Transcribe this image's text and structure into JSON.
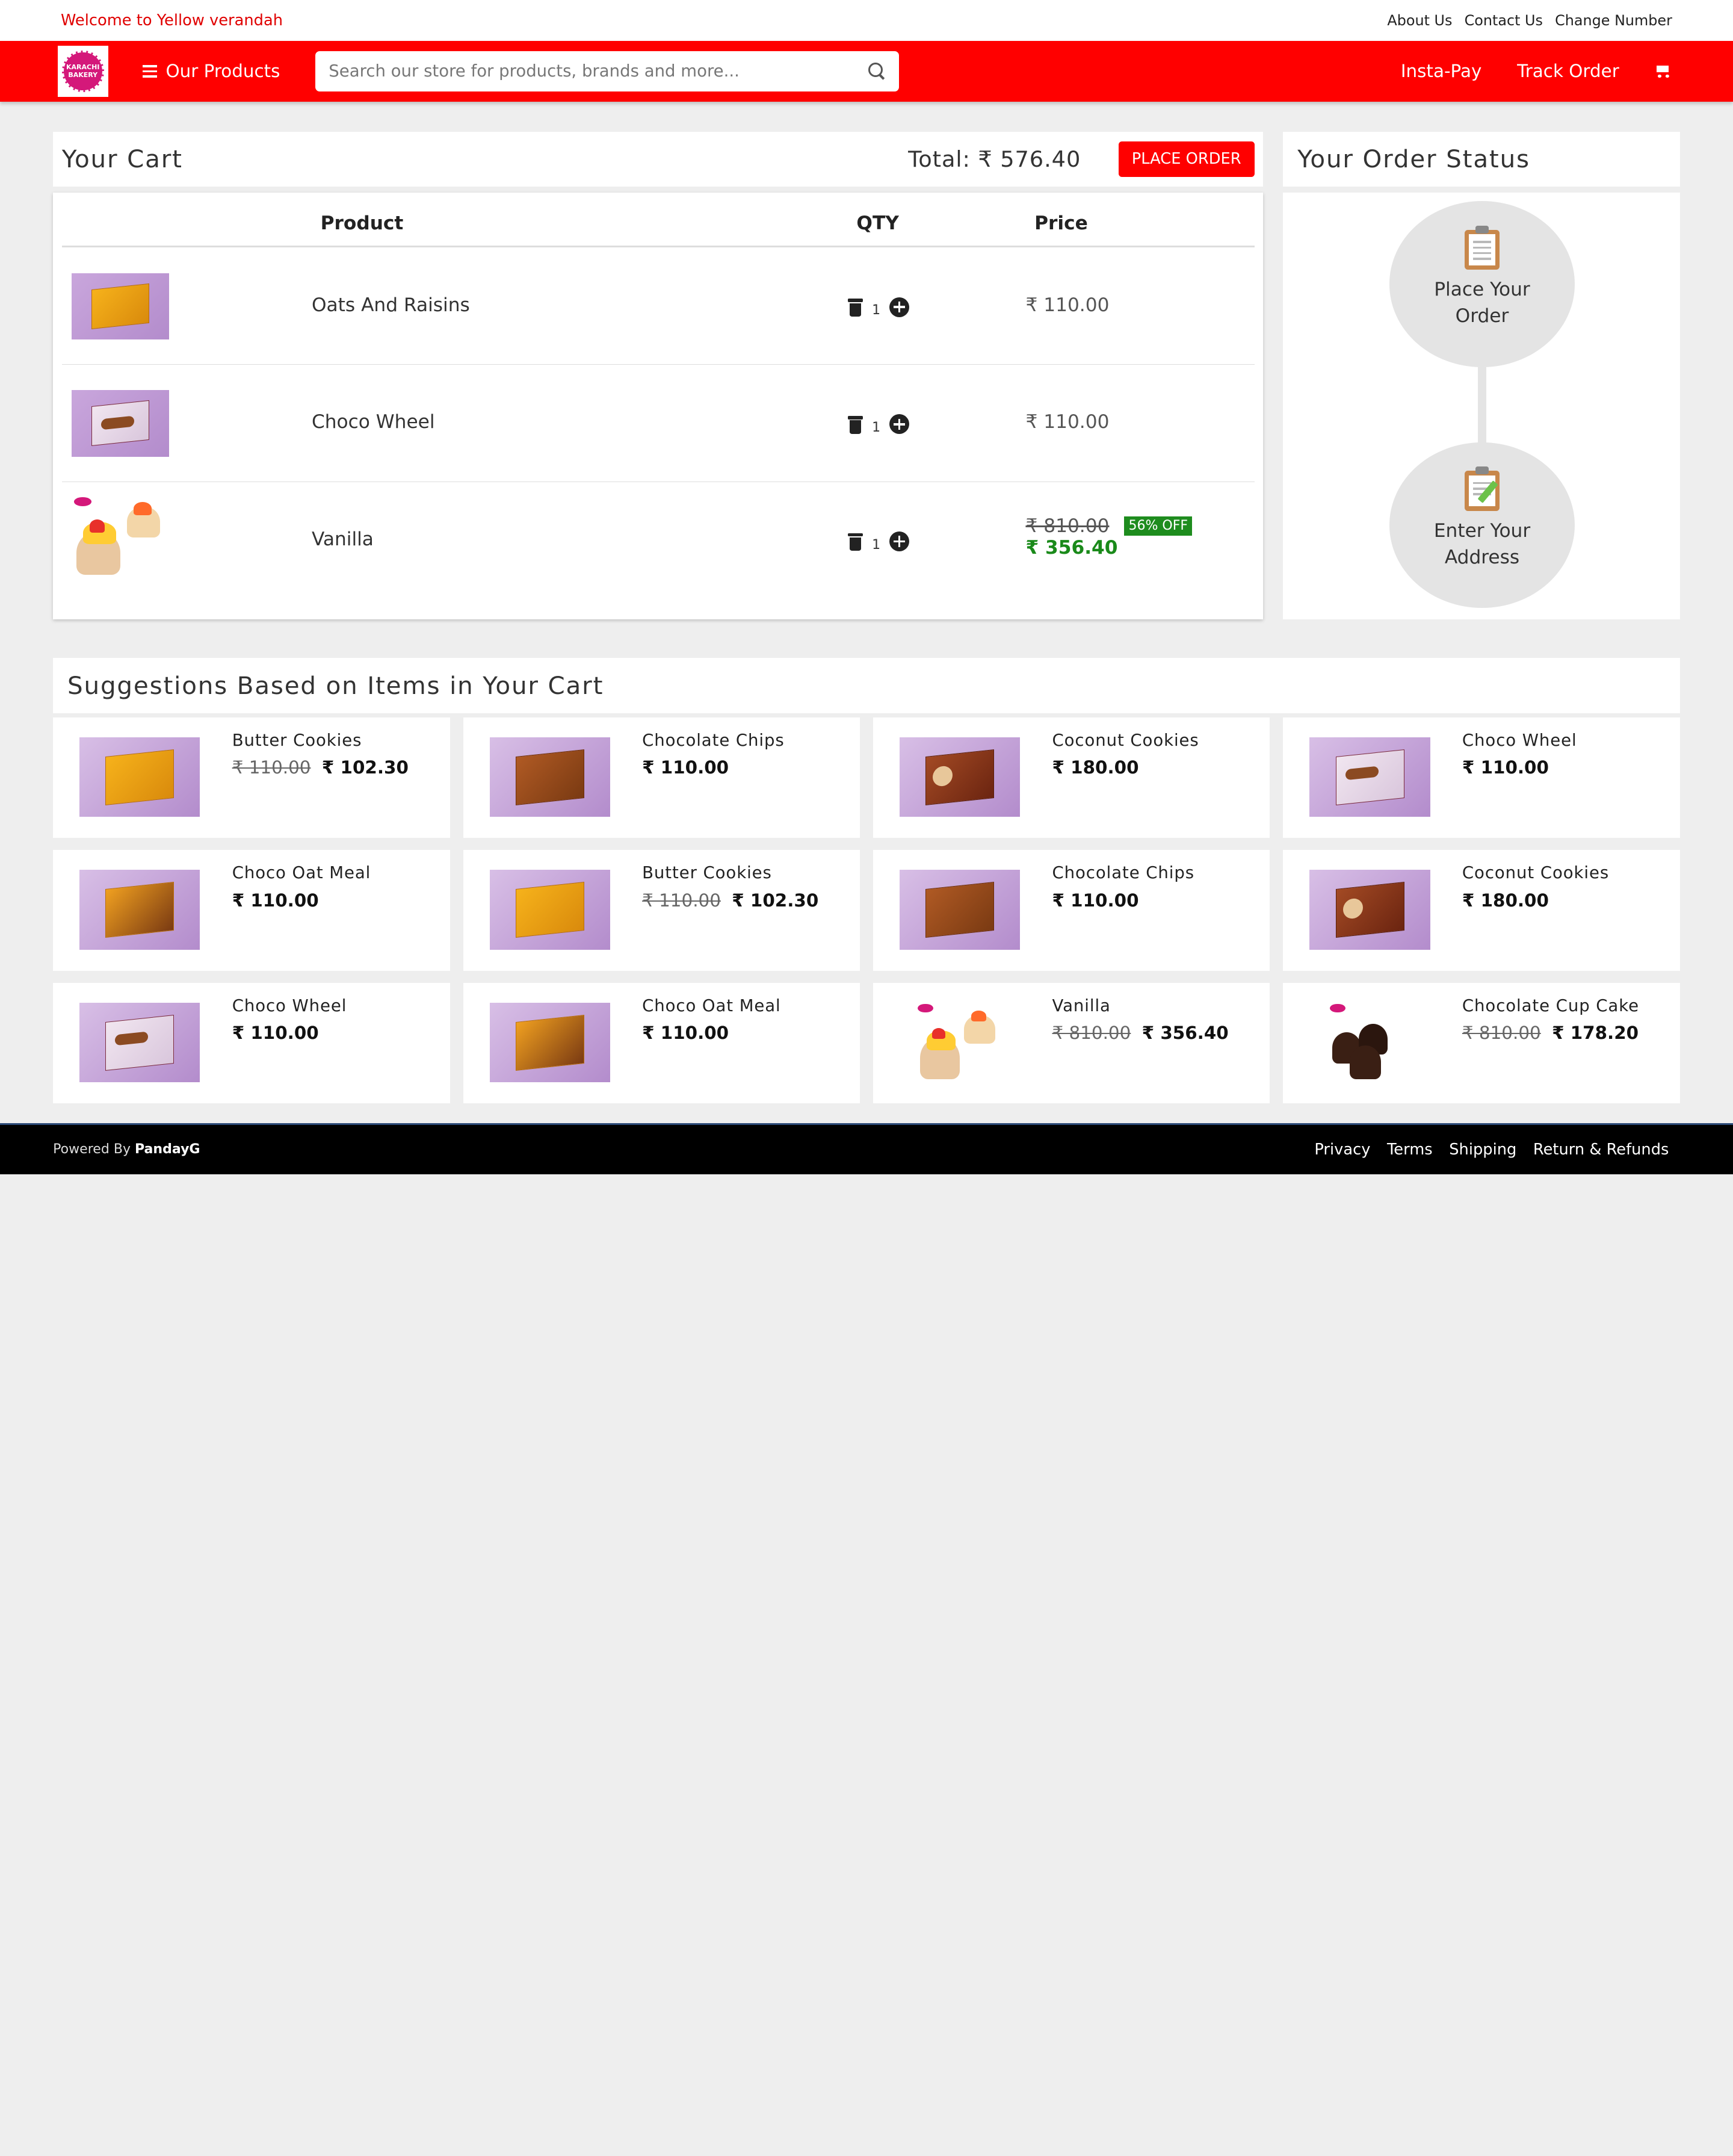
{
  "topbar": {
    "welcome": "Welcome to Yellow verandah",
    "links": [
      "About Us",
      "Contact Us",
      "Change Number"
    ]
  },
  "navbar": {
    "logo_text": "KARACHI BAKERY",
    "menu_label": "Our Products",
    "search_placeholder": "Search our store for products, brands and more...",
    "insta_pay": "Insta-Pay",
    "track_order": "Track Order",
    "icons": [
      "hamburger-icon",
      "search-icon",
      "cart-icon"
    ]
  },
  "cart": {
    "title": "Your Cart",
    "total": "Total: ₹ 576.40",
    "place_order": "PLACE ORDER",
    "headers": {
      "product": "Product",
      "qty": "QTY",
      "price": "Price"
    },
    "items": [
      {
        "name": "Oats And Raisins",
        "qty": "1",
        "price": "₹ 110.00"
      },
      {
        "name": "Choco Wheel",
        "qty": "1",
        "price": "₹ 110.00"
      },
      {
        "name": "Vanilla",
        "qty": "1",
        "price_old": "₹ 810.00",
        "discount": "56% OFF",
        "price_new": "₹ 356.40"
      }
    ]
  },
  "order_status": {
    "title": "Your Order Status",
    "steps": [
      {
        "label_1": "Place Your",
        "label_2": "Order"
      },
      {
        "label_1": "Enter Your",
        "label_2": "Address"
      }
    ]
  },
  "suggestions": {
    "title": "Suggestions Based on Items in Your Cart",
    "items": [
      {
        "name": "Butter Cookies",
        "old": "₹ 110.00",
        "price": "₹ 102.30"
      },
      {
        "name": "Chocolate Chips",
        "old": "",
        "price": "₹ 110.00"
      },
      {
        "name": "Coconut Cookies",
        "old": "",
        "price": "₹ 180.00"
      },
      {
        "name": "Choco Wheel",
        "old": "",
        "price": "₹ 110.00"
      },
      {
        "name": "Choco Oat Meal",
        "old": "",
        "price": "₹ 110.00"
      },
      {
        "name": "Butter Cookies",
        "old": "₹ 110.00",
        "price": "₹ 102.30"
      },
      {
        "name": "Chocolate Chips",
        "old": "",
        "price": "₹ 110.00"
      },
      {
        "name": "Coconut Cookies",
        "old": "",
        "price": "₹ 180.00"
      },
      {
        "name": "Choco Wheel",
        "old": "",
        "price": "₹ 110.00"
      },
      {
        "name": "Choco Oat Meal",
        "old": "",
        "price": "₹ 110.00"
      },
      {
        "name": "Vanilla",
        "old": "₹ 810.00",
        "price": "₹ 356.40"
      },
      {
        "name": "Chocolate Cup Cake",
        "old": "₹ 810.00",
        "price": "₹ 178.20"
      }
    ]
  },
  "footer": {
    "powered_prefix": "Powered By",
    "powered_name": "PandayG",
    "links": [
      "Privacy",
      "Terms",
      "Shipping",
      "Return & Refunds"
    ]
  },
  "colors": {
    "brand_red": "#ff0000",
    "discount_green": "#1e8c1e",
    "background": "#eeeeee"
  }
}
